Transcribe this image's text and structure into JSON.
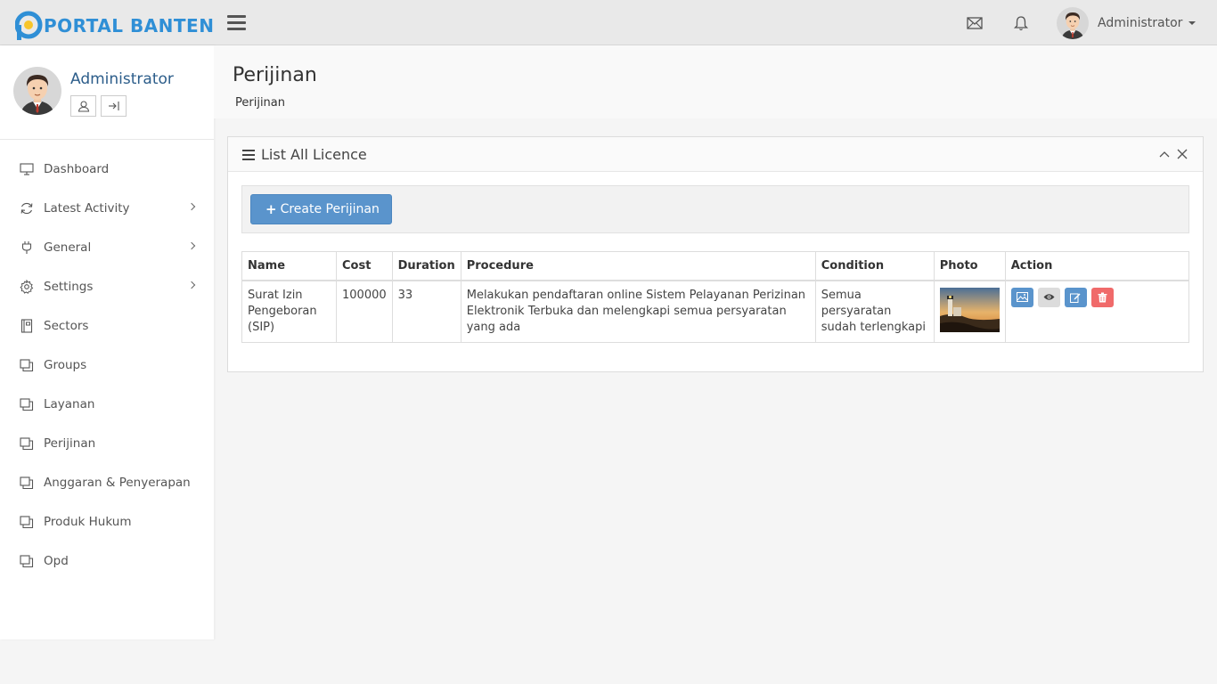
{
  "brand": {
    "logo_text": "PORTAL BANTEN",
    "accent": "#2f8fd6",
    "logo_dot_color": "#f7c52b"
  },
  "topbar": {
    "user_name": "Administrator"
  },
  "sidebar": {
    "profile_name": "Administrator",
    "items": [
      {
        "label": "Dashboard",
        "icon": "monitor-icon",
        "has_children": false
      },
      {
        "label": "Latest Activity",
        "icon": "refresh-icon",
        "has_children": true
      },
      {
        "label": "General",
        "icon": "plug-icon",
        "has_children": true
      },
      {
        "label": "Settings",
        "icon": "gear-icon",
        "has_children": true
      },
      {
        "label": "Sectors",
        "icon": "book-icon",
        "has_children": false
      },
      {
        "label": "Groups",
        "icon": "window-icon",
        "has_children": false
      },
      {
        "label": "Layanan",
        "icon": "window-icon",
        "has_children": false
      },
      {
        "label": "Perijinan",
        "icon": "window-icon",
        "has_children": false
      },
      {
        "label": "Anggaran & Penyerapan",
        "icon": "window-icon",
        "has_children": false
      },
      {
        "label": "Produk Hukum",
        "icon": "window-icon",
        "has_children": false
      },
      {
        "label": "Opd",
        "icon": "window-icon",
        "has_children": false
      }
    ]
  },
  "page": {
    "title": "Perijinan",
    "breadcrumb": "Perijinan"
  },
  "panel": {
    "title": "List All Licence",
    "create_button": "Create Perijinan",
    "columns": [
      "Name",
      "Cost",
      "Duration",
      "Procedure",
      "Condition",
      "Photo",
      "Action"
    ],
    "rows": [
      {
        "name": "Surat Izin Pengeboran (SIP)",
        "cost": "100000",
        "duration": "33",
        "procedure": "Melakukan pendaftaran online Sistem Pelayanan Perizinan Elektronik Terbuka dan melengkapi semua persyaratan yang ada",
        "condition": "Semua persyaratan sudah terlengkapi"
      }
    ]
  },
  "colors": {
    "btn_primary": "#5a94cc",
    "btn_view": "#dcdcdc",
    "btn_delete": "#f06a6a"
  }
}
